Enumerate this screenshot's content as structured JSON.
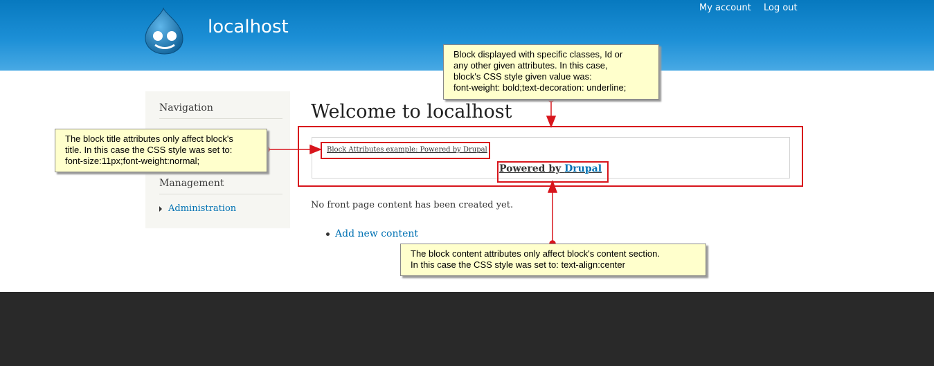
{
  "header": {
    "site_name": "localhost",
    "secondary_menu": [
      "My account",
      "Log out"
    ]
  },
  "sidebar": {
    "navigation_title": "Navigation",
    "management_title": "Management",
    "management_items": [
      "Administration"
    ]
  },
  "main": {
    "page_title": "Welcome to localhost",
    "block": {
      "title": "Block Attributes example: Powered by Drupal",
      "content_prefix": "Powered by ",
      "content_link": "Drupal"
    },
    "no_content_text": "No front page content has been created yet.",
    "add_content_link": "Add new content"
  },
  "callouts": {
    "top": [
      "Block displayed with specific classes, Id or",
      "any other given attributes. In this case,",
      "block's CSS style given value was:",
      "font-weight: bold;text-decoration: underline;"
    ],
    "left": [
      "The block title attributes only affect block's",
      "title. In this case the CSS style was set to:",
      "font-size:11px;font-weight:normal;"
    ],
    "bottom": [
      "The block content attributes only affect block's content section.",
      "In this case the CSS style was set to: text-align:center"
    ]
  },
  "colors": {
    "header_blue": "#0779bf",
    "link_blue": "#0071b3",
    "annotation_red": "#d8151c",
    "callout_yellow": "#ffffcc",
    "footer_dark": "#292929"
  },
  "icons": {
    "logo": "drupal-drop-logo",
    "menu_bullet": "triangle-right-icon"
  }
}
